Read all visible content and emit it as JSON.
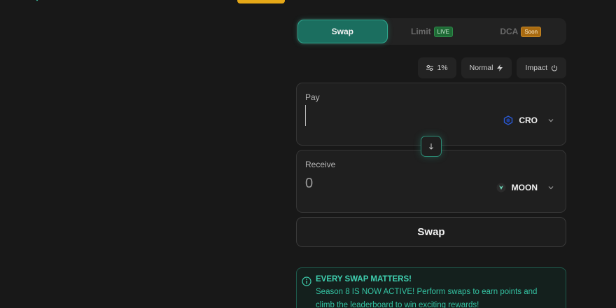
{
  "tabs": [
    {
      "label": "Swap",
      "badge": ""
    },
    {
      "label": "Limit",
      "badge": "LIVE"
    },
    {
      "label": "DCA",
      "badge": "Soon"
    }
  ],
  "options": {
    "slippage": "1%",
    "speed": "Normal",
    "impact": "Impact"
  },
  "pay": {
    "label": "Pay",
    "amount": "",
    "token": "CRO"
  },
  "receive": {
    "label": "Receive",
    "amount": "0",
    "token": "MOON"
  },
  "swap_button": "Swap",
  "notice": {
    "title": "EVERY SWAP MATTERS!",
    "body": "Season 8 IS NOW ACTIVE! Perform swaps to earn points and climb the leaderboard to win exciting rewards!"
  },
  "colors": {
    "accent": "#1b6e5f",
    "live_badge": "#1e6a35",
    "soon_badge": "#a86a10",
    "notice_text": "#34c2a2",
    "top_accent": "#e6a817"
  }
}
